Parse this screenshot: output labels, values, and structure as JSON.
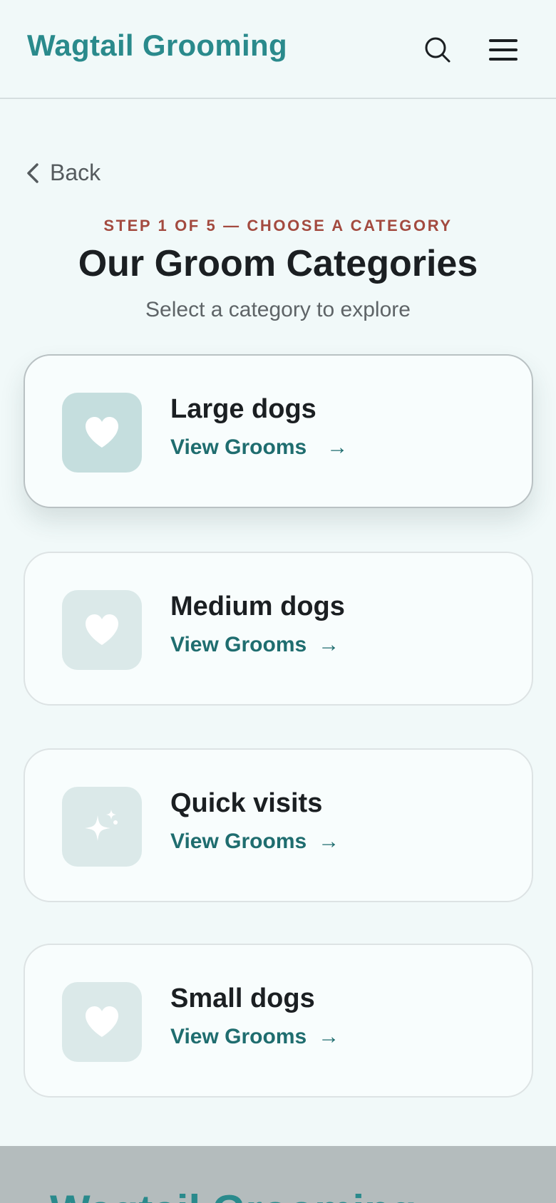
{
  "header": {
    "brand": "Wagtail Grooming",
    "search_icon": "search-icon",
    "menu_icon": "hamburger-menu-icon"
  },
  "nav": {
    "back_label": "Back",
    "back_icon": "chevron-left-icon"
  },
  "intro": {
    "step": "STEP 1 OF 5 — CHOOSE A CATEGORY",
    "title": "Our Groom Categories",
    "subtitle": "Select a category to explore"
  },
  "categories": [
    {
      "title": "Large dogs",
      "link": "View Grooms",
      "arrow": "→",
      "icon": "heart-icon",
      "active": true
    },
    {
      "title": "Medium dogs",
      "link": "View Grooms",
      "arrow": "→",
      "icon": "heart-icon",
      "active": false
    },
    {
      "title": "Quick visits",
      "link": "View Grooms",
      "arrow": "→",
      "icon": "sparkle-icon",
      "active": false
    },
    {
      "title": "Small dogs",
      "link": "View Grooms",
      "arrow": "→",
      "icon": "heart-icon",
      "active": false
    }
  ],
  "footer": {
    "brand": "Wagtail Grooming"
  },
  "colors": {
    "brand": "#2a8a8c",
    "step_accent": "#a34a3f",
    "link": "#1f6d6f",
    "background": "#f1f9f9"
  }
}
